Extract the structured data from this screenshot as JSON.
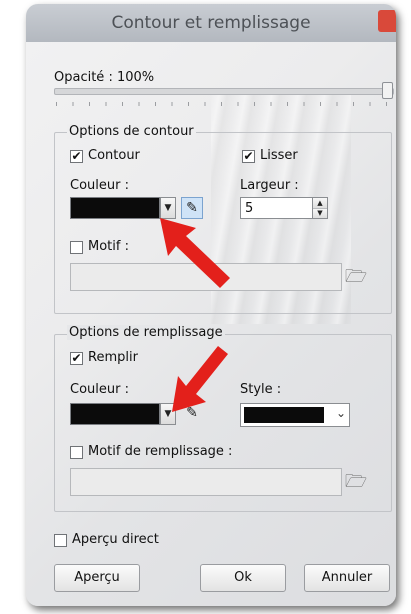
{
  "window": {
    "title": "Contour et remplissage"
  },
  "opacity": {
    "label": "Opacité : 100%",
    "value_percent": 100
  },
  "contour": {
    "group_label": "Options de contour",
    "contour_checkbox_label": "Contour",
    "contour_checked": true,
    "lisser_checkbox_label": "Lisser",
    "lisser_checked": true,
    "couleur_label": "Couleur :",
    "color": "#0b0b0b",
    "largeur_label": "Largeur :",
    "largeur_value": "5",
    "motif_checkbox_label": "Motif :",
    "motif_checked": false
  },
  "fill": {
    "group_label": "Options de remplissage",
    "remplir_checkbox_label": "Remplir",
    "remplir_checked": true,
    "couleur_label": "Couleur :",
    "color": "#0b0b0b",
    "style_label": "Style :",
    "style_value_color": "#0b0b0b",
    "motif_checkbox_label": "Motif de remplissage :",
    "motif_checked": false
  },
  "preview": {
    "checkbox_label": "Aperçu direct",
    "checked": false
  },
  "buttons": {
    "apercu": "Aperçu",
    "ok": "Ok",
    "annuler": "Annuler"
  },
  "icons": {
    "dropdown": "chevron-down-icon",
    "eyedropper": "eyedropper-icon",
    "folder": "folder-open-icon",
    "arrow": "red-arrow-icon"
  },
  "colors": {
    "arrow": "#e3201b",
    "titlebar": "#b8bcc2",
    "close": "#d9493a"
  }
}
